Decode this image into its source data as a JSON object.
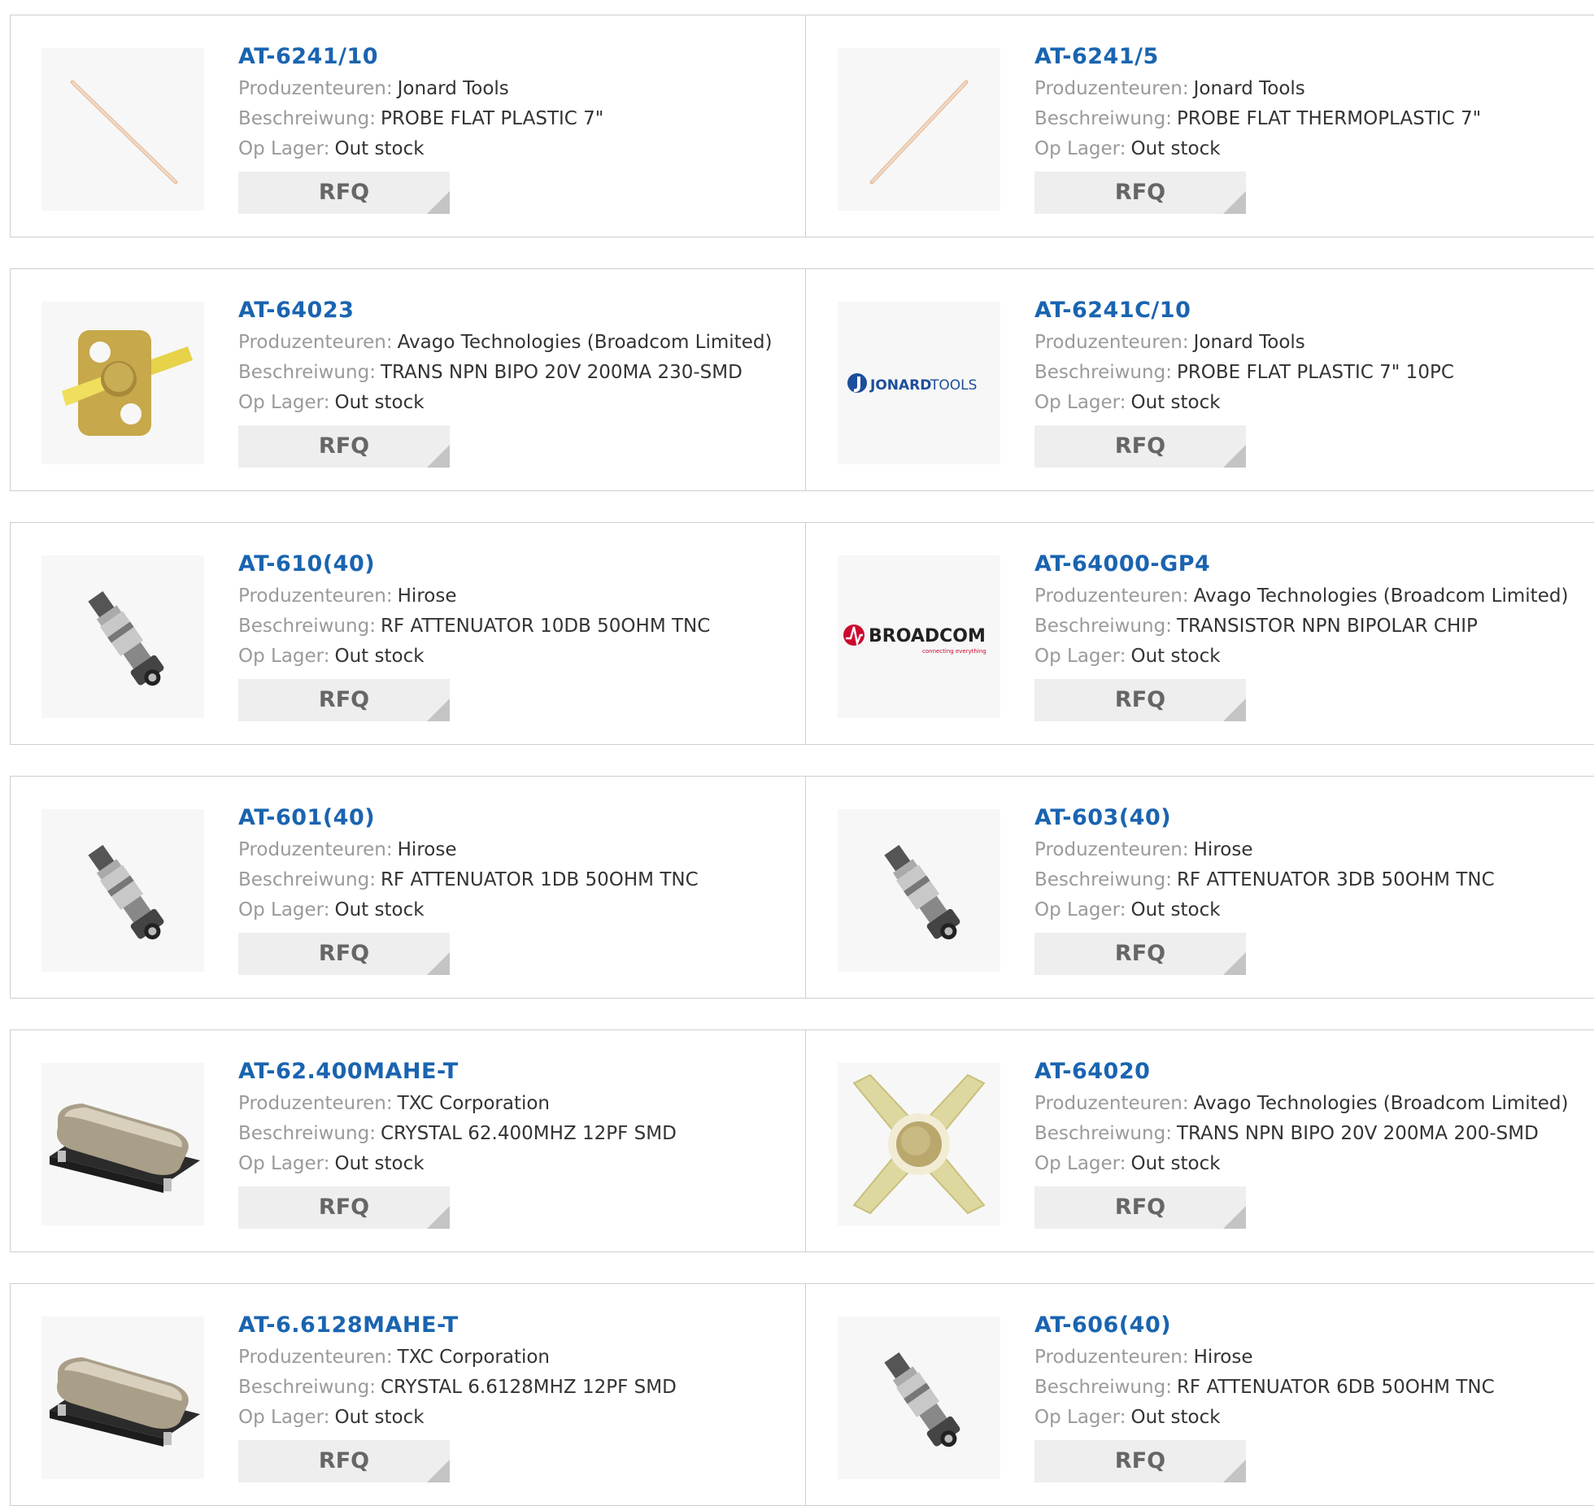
{
  "labels": {
    "manufacturer": "Produzenteuren:",
    "description": "Beschreiwung:",
    "stock": "Op Lager:",
    "rfq": "RFQ"
  },
  "products": [
    {
      "part": "AT-6241/10",
      "manufacturer": "Jonard Tools",
      "description": "PROBE FLAT PLASTIC 7\"",
      "stock": "Out stock",
      "image": "probe-image"
    },
    {
      "part": "AT-6241/5",
      "manufacturer": "Jonard Tools",
      "description": "PROBE FLAT THERMOPLASTIC 7\"",
      "stock": "Out stock",
      "image": "probe-image"
    },
    {
      "part": "AT-64023",
      "manufacturer": "Avago Technologies (Broadcom Limited)",
      "description": "TRANS NPN BIPO 20V 200MA 230-SMD",
      "stock": "Out stock",
      "image": "smd-transistor-image"
    },
    {
      "part": "AT-6241C/10",
      "manufacturer": "Jonard Tools",
      "description": "PROBE FLAT PLASTIC 7\" 10PC",
      "stock": "Out stock",
      "image": "jonard-tools-logo",
      "logo_text": "JONARDTOOLS"
    },
    {
      "part": "AT-610(40)",
      "manufacturer": "Hirose",
      "description": "RF ATTENUATOR 10DB 50OHM TNC",
      "stock": "Out stock",
      "image": "rf-attenuator-image"
    },
    {
      "part": "AT-64000-GP4",
      "manufacturer": "Avago Technologies (Broadcom Limited)",
      "description": "TRANSISTOR NPN BIPOLAR CHIP",
      "stock": "Out stock",
      "image": "broadcom-logo",
      "logo_text": "BROADCOM",
      "logo_tagline": "connecting everything"
    },
    {
      "part": "AT-601(40)",
      "manufacturer": "Hirose",
      "description": "RF ATTENUATOR 1DB 50OHM TNC",
      "stock": "Out stock",
      "image": "rf-attenuator-image"
    },
    {
      "part": "AT-603(40)",
      "manufacturer": "Hirose",
      "description": "RF ATTENUATOR 3DB 50OHM TNC",
      "stock": "Out stock",
      "image": "rf-attenuator-image"
    },
    {
      "part": "AT-62.400MAHE-T",
      "manufacturer": "TXC Corporation",
      "description": "CRYSTAL 62.400MHZ 12PF SMD",
      "stock": "Out stock",
      "image": "crystal-image"
    },
    {
      "part": "AT-64020",
      "manufacturer": "Avago Technologies (Broadcom Limited)",
      "description": "TRANS NPN BIPO 20V 200MA 200-SMD",
      "stock": "Out stock",
      "image": "cross-transistor-image"
    },
    {
      "part": "AT-6.6128MAHE-T",
      "manufacturer": "TXC Corporation",
      "description": "CRYSTAL 6.6128MHZ 12PF SMD",
      "stock": "Out stock",
      "image": "crystal-image"
    },
    {
      "part": "AT-606(40)",
      "manufacturer": "Hirose",
      "description": "RF ATTENUATOR 6DB 50OHM TNC",
      "stock": "Out stock",
      "image": "rf-attenuator-image"
    }
  ],
  "colors": {
    "part_link": "#1a64b0",
    "label": "#9a9a9a",
    "border": "#cfcfcf",
    "button_bg": "#eeeeee",
    "broadcom_red": "#cc092f",
    "jonard_blue": "#1d4e9b"
  }
}
